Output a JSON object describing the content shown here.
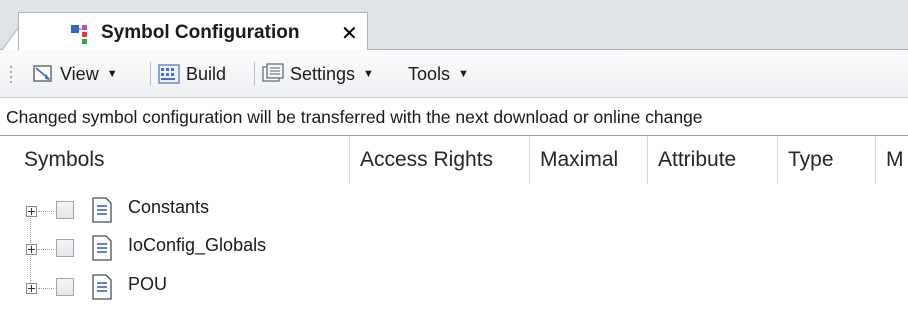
{
  "tab": {
    "title": "Symbol Configuration",
    "close_glyph": "✕",
    "icon": "symbol-configuration-icon"
  },
  "toolbar": {
    "view_label": "View",
    "build_label": "Build",
    "settings_label": "Settings",
    "tools_label": "Tools",
    "dropdown_glyph": "▼"
  },
  "info_message": "Changed symbol configuration will be transferred with the next download or online change",
  "columns": [
    {
      "label": "Symbols"
    },
    {
      "label": "Access Rights"
    },
    {
      "label": "Maximal"
    },
    {
      "label": "Attribute"
    },
    {
      "label": "Type"
    },
    {
      "label": "M"
    }
  ],
  "tree": {
    "items": [
      {
        "label": "Constants",
        "checked": false,
        "expanded": false
      },
      {
        "label": "IoConfig_Globals",
        "checked": false,
        "expanded": false
      },
      {
        "label": "POU",
        "checked": false,
        "expanded": false
      }
    ]
  },
  "colors": {
    "tab_strip_bg": "#dfe3e8",
    "border": "#a9b2bd",
    "icon_blue": "#3a64c8",
    "icon_magenta": "#d23cc8",
    "icon_red": "#e23a3a",
    "icon_green": "#2fa84f"
  }
}
